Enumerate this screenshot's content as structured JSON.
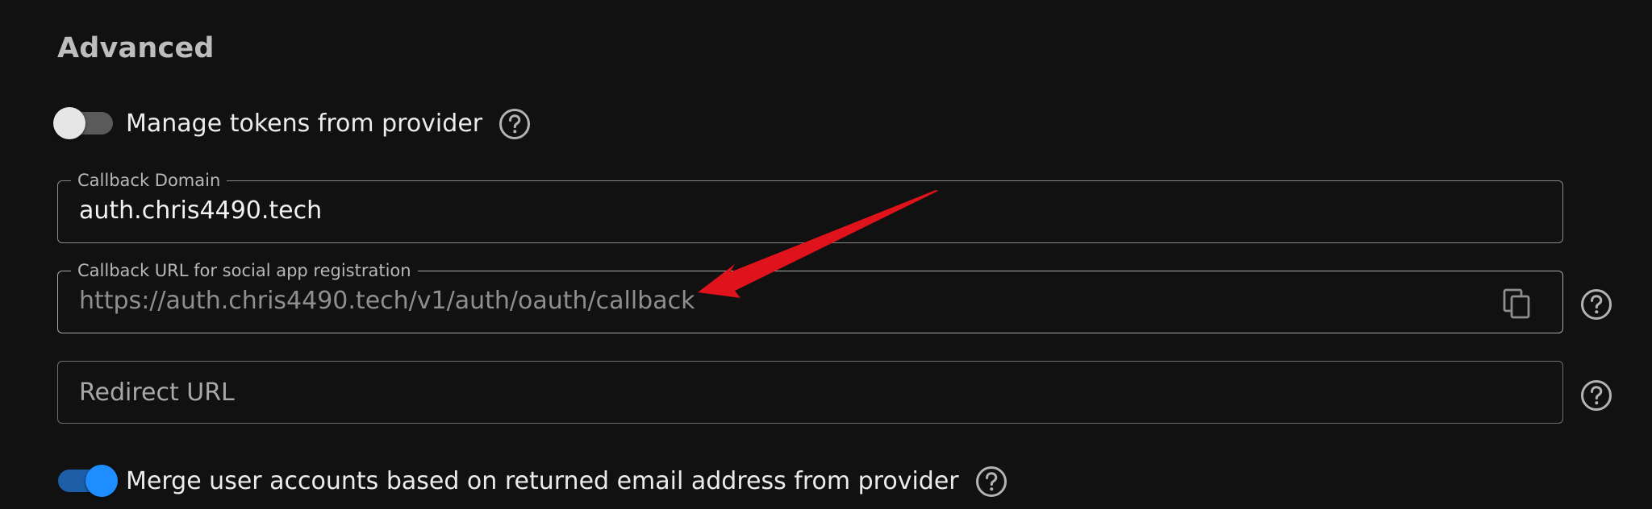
{
  "section": {
    "title": "Advanced"
  },
  "manage_tokens": {
    "label": "Manage tokens from provider",
    "enabled": false
  },
  "callback_domain": {
    "label": "Callback Domain",
    "value": "auth.chris4490.tech"
  },
  "callback_url": {
    "label": "Callback URL for social app registration",
    "value": "https://auth.chris4490.tech/v1/auth/oauth/callback"
  },
  "redirect_url": {
    "placeholder": "Redirect URL",
    "value": ""
  },
  "merge_accounts": {
    "label": "Merge user accounts based on returned email address from provider",
    "enabled": true
  },
  "icons": {
    "help": "help-circle-icon",
    "copy": "copy-icon",
    "annotation": "red-arrow-annotation"
  },
  "colors": {
    "background": "#111111",
    "toggle_on": "#1e8dff",
    "toggle_off_track": "#5a5a5a",
    "annotation_arrow": "#e0121b"
  }
}
